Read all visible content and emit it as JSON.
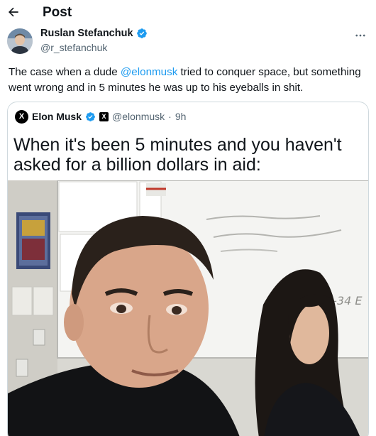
{
  "header": {
    "title": "Post",
    "back_icon": "arrow-left-icon"
  },
  "author": {
    "name": "Ruslan Stefanchuk",
    "handle": "@r_stefanchuk",
    "verified_color": "#1d9bf0"
  },
  "tweet": {
    "text_before": "The case when a dude ",
    "mention": "@elonmusk",
    "text_after": " tried to conquer space, but something went wrong and in 5 minutes he was up to his eyeballs in shit."
  },
  "quote": {
    "name": "Elon Musk",
    "handle": "@elonmusk",
    "separator": " · ",
    "time": "9h",
    "caption": "When it's been 5 minutes and you haven't asked for a billion dollars in aid:",
    "board_note": "4-34 E"
  },
  "colors": {
    "accent": "#1d9bf0",
    "text": "#0f1419",
    "muted": "#536471",
    "border": "#cfd9de"
  }
}
